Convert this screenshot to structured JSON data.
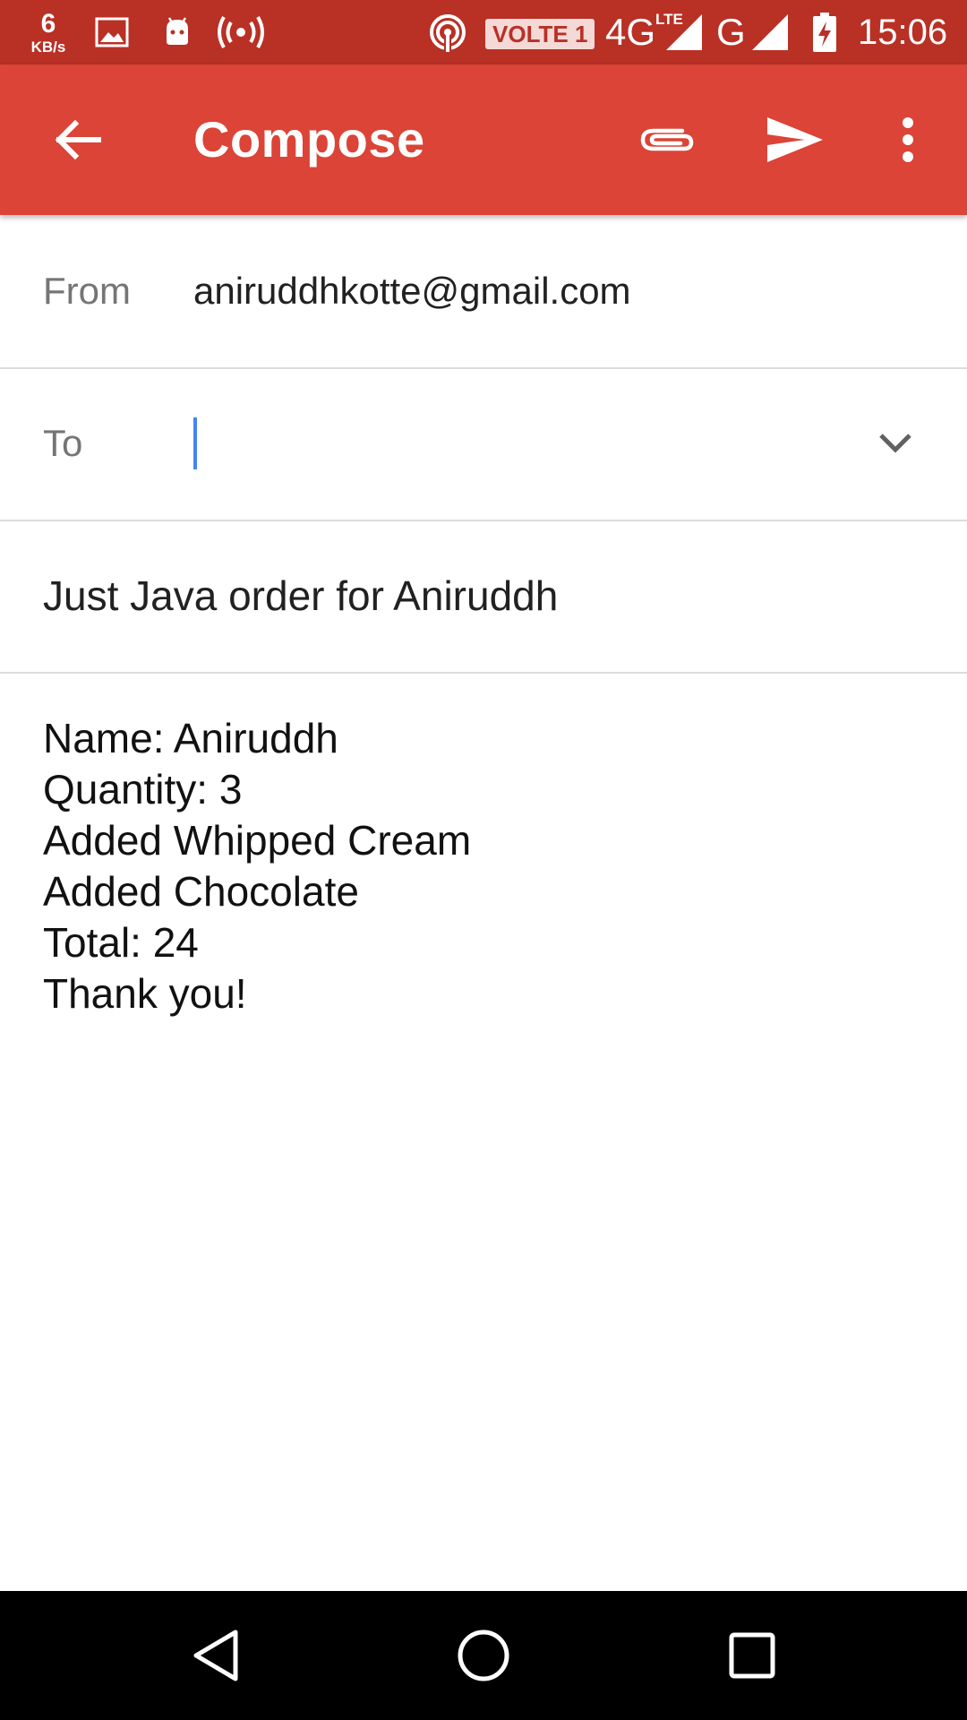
{
  "status_bar": {
    "net_speed_value": "6",
    "net_speed_unit": "KB/s",
    "volte_label": "VOLTE 1",
    "network_4g": "4G",
    "network_lte": "LTE",
    "network_g": "G",
    "time": "15:06",
    "icons": [
      "gallery-icon",
      "android-icon",
      "wifi-hotspot-icon",
      "hotspot-icon",
      "signal-icon",
      "battery-charging-icon"
    ]
  },
  "app_bar": {
    "title": "Compose",
    "icons": [
      "back-arrow-icon",
      "attach-icon",
      "send-icon",
      "more-vert-icon"
    ],
    "color": "#db4437",
    "status_color": "#b93025"
  },
  "form": {
    "from_label": "From",
    "from_value": "aniruddhkotte@gmail.com",
    "to_label": "To",
    "to_value": "",
    "subject": "Just Java order for Aniruddh",
    "body_lines": [
      "Name: Aniruddh",
      "Quantity: 3",
      "Added Whipped Cream",
      "Added Chocolate",
      "Total: 24",
      "Thank you!"
    ],
    "cursor_color": "#4285f4"
  },
  "nav_bar": {
    "icons": [
      "nav-back-icon",
      "nav-home-icon",
      "nav-recents-icon"
    ]
  }
}
